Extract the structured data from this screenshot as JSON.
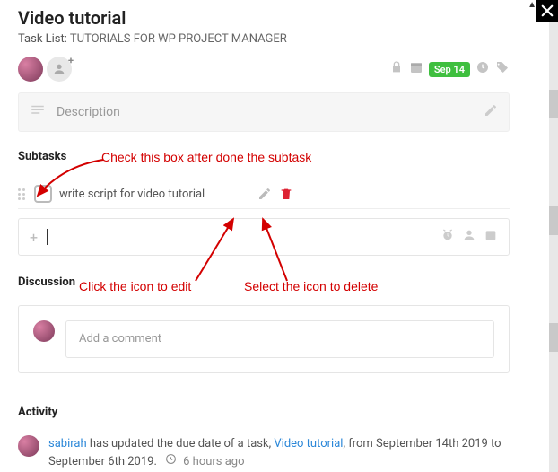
{
  "header": {
    "title": "Video tutorial",
    "tasklist_prefix": "Task List:",
    "tasklist_name": "TUTORIALS FOR WP PROJECT MANAGER",
    "date_badge": "Sep 14"
  },
  "description": {
    "placeholder": "Description"
  },
  "subtasks": {
    "heading": "Subtasks",
    "items": [
      {
        "title": "write script for video tutorial"
      }
    ],
    "add_placeholder": ""
  },
  "discussion": {
    "heading": "Discussion",
    "comment_placeholder": "Add a comment"
  },
  "activity": {
    "heading": "Activity",
    "items": [
      {
        "user": "sabirah",
        "text_before": " has updated the due date of a task, ",
        "task": "Video tutorial",
        "text_after": ", from September 14th 2019 to September 6th 2019.",
        "ago": "6 hours ago"
      }
    ]
  },
  "annotations": {
    "check": "Check this box after done the subtask",
    "edit": "Click the icon to edit",
    "delete": "Select the icon to delete"
  }
}
